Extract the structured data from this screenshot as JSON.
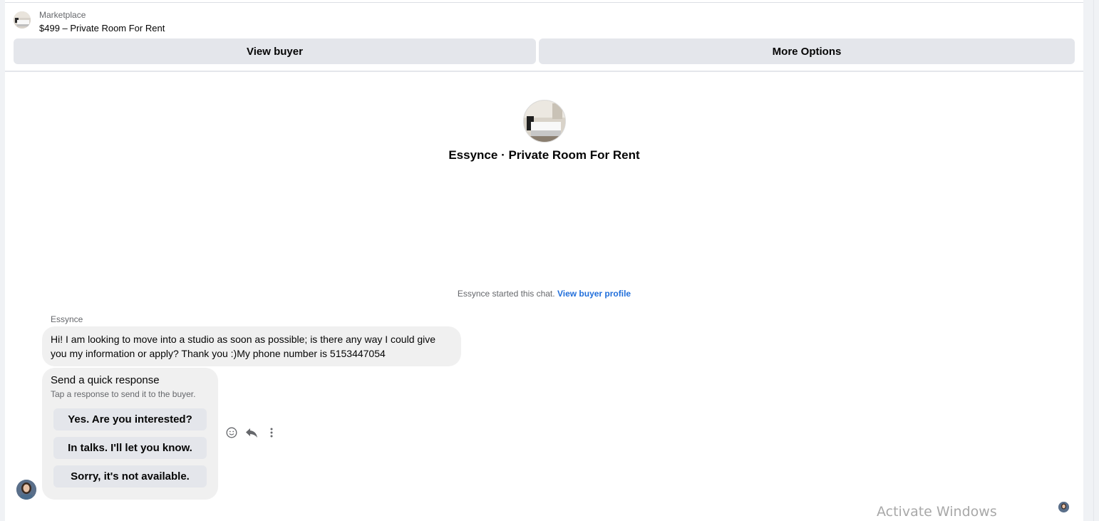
{
  "header": {
    "marketplace_label": "Marketplace",
    "listing_title": "$499 – Private Room For Rent",
    "view_buyer_label": "View buyer",
    "more_options_label": "More Options"
  },
  "product": {
    "title": "Essynce · Private Room For Rent"
  },
  "chat": {
    "started_text": "Essynce started this chat.",
    "view_buyer_profile_label": "View buyer profile",
    "sender_name": "Essynce",
    "message_text": "Hi! I am looking to move into a studio as soon as possible; is there any way I could give you my information or apply? Thank you :)My phone number is 5153447054"
  },
  "quick_response": {
    "title": "Send a quick response",
    "subtitle": "Tap a response to send it to the buyer.",
    "options": [
      "Yes. Are you interested?",
      "In talks. I'll let you know.",
      "Sorry, it's not available."
    ]
  },
  "system": {
    "watermark": "Activate Windows"
  },
  "colors": {
    "link": "#216fdb",
    "button_bg": "#e4e6eb",
    "bubble_bg": "#f0f0f0",
    "secondary_text": "#65676b"
  },
  "icons": {
    "react": "smiley-icon",
    "reply": "reply-arrow-icon",
    "more": "vertical-dots-icon"
  }
}
